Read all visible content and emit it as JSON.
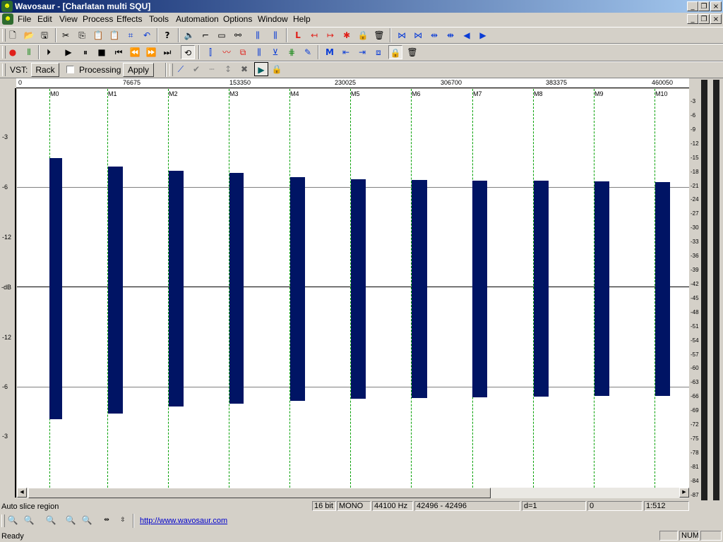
{
  "app": {
    "title": "Wavosaur - [Charlatan multi SQU]",
    "icon": "wavosaur-logo"
  },
  "caption_buttons": {
    "minimize": "_",
    "restore": "❐",
    "close": "×"
  },
  "menu": [
    "File",
    "Edit",
    "View",
    "Process",
    "Effects",
    "Tools",
    "Automation",
    "Options",
    "Window",
    "Help"
  ],
  "toolbar1": {
    "file_icons": [
      "new-file-icon",
      "open-folder-icon",
      "save-icon"
    ],
    "edit_icons": [
      "cut-icon",
      "copy-icon",
      "paste-icon",
      "paste-mix-icon",
      "crop-icon",
      "undo-icon"
    ],
    "help_icon": "help-icon",
    "process_icons": [
      "speaker-icon",
      "trim-icon",
      "silence-icon",
      "link-icon",
      "normalize-icon",
      "fade-icon",
      "marker-red-icon",
      "marker-left-icon",
      "marker-right-icon",
      "slice-icon",
      "lock-icon",
      "trash-icon",
      "zoom-in-wave-icon",
      "zoom-out-wave-icon",
      "split-icon",
      "join-icon",
      "prev-icon",
      "next-icon"
    ]
  },
  "toolbar2": {
    "transport_icons": [
      "record-icon",
      "vu-icon",
      "play-from-start-icon",
      "play-icon",
      "pause-icon",
      "stop-icon",
      "go-start-icon",
      "rewind-icon",
      "forward-icon",
      "go-end-icon",
      "loop-icon"
    ],
    "tool_icons": [
      "select-region-icon",
      "pencil-wave-icon",
      "copy-region-icon",
      "waveform-icon",
      "clip-icon",
      "grid-icon",
      "draw-icon",
      "marker-m-icon",
      "snap-left-icon",
      "snap-right-icon",
      "select-all-icon",
      "lock2-icon",
      "delete-icon"
    ]
  },
  "vst": {
    "label": "VST:",
    "rack_button": "Rack",
    "processing_label": "Processing",
    "processing_checked": false,
    "apply_button": "Apply"
  },
  "vst_icons": [
    "envelope-icon",
    "check-icon",
    "dotted-line-icon",
    "arrows-icon",
    "cross-icon",
    "play-box-icon",
    "lock3-icon"
  ],
  "ruler": [
    "0",
    "76675",
    "153350",
    "230025",
    "306700",
    "383375",
    "460050"
  ],
  "markers": [
    "M0",
    "M1",
    "M2",
    "M3",
    "M4",
    "M5",
    "M6",
    "M7",
    "M8",
    "M9",
    "M10"
  ],
  "left_axis": [
    "-3",
    "-6",
    "-12",
    "-dB",
    "-12",
    "-6",
    "-3"
  ],
  "vu_scale": [
    "-3",
    "-6",
    "-9",
    "-12",
    "-15",
    "-18",
    "-21",
    "-24",
    "-27",
    "-30",
    "-33",
    "-36",
    "-39",
    "-42",
    "-45",
    "-48",
    "-51",
    "-54",
    "-57",
    "-60",
    "-63",
    "-66",
    "-69",
    "-72",
    "-75",
    "-78",
    "-81",
    "-84",
    "-87"
  ],
  "status": {
    "message": "Auto slice region",
    "bit_depth": "16 bit",
    "channels": "MONO",
    "sample_rate": "44100 Hz",
    "selection": "42496 - 42496",
    "delta": "d=1",
    "position": "0",
    "zoom": "1:512",
    "ready": "Ready",
    "num": "NUM"
  },
  "bottom_icons": [
    "zoom-in-icon",
    "zoom-out-icon",
    "zoom-fit-icon",
    "zoom-selection-in-icon",
    "zoom-selection-out-icon",
    "zoom-x-icon",
    "zoom-y-icon"
  ],
  "website": "http://www.wavosaur.com",
  "colors": {
    "waveform": "#001464",
    "marker": "#00a000",
    "titlebar_start": "#0a246a",
    "titlebar_end": "#a6caf0"
  }
}
